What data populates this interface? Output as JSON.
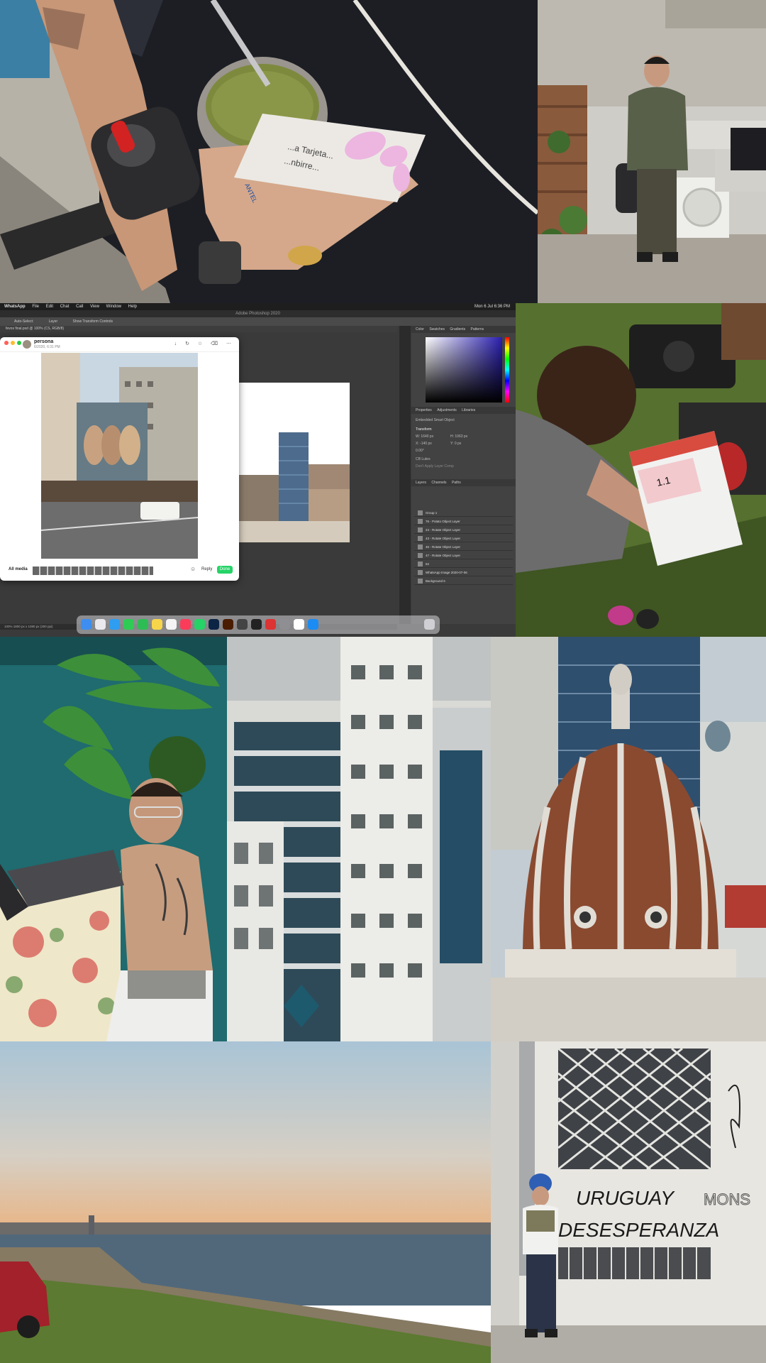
{
  "collage": {
    "tiles": [
      {
        "id": "mate-tile",
        "subject": "hand holding mate gourd with yerba, thermos and card"
      },
      {
        "id": "man-terrace-tile",
        "subject": "man in green jacket standing on rooftop terrace"
      },
      {
        "id": "screenshot-tile",
        "subject": "desktop screenshot of Photoshop and WhatsApp"
      },
      {
        "id": "film-slate-tile",
        "subject": "person writing on a film slate over gear on grass"
      },
      {
        "id": "tattoo-man-tile",
        "subject": "tattooed man at laptop among plants"
      },
      {
        "id": "buildings-tile",
        "subject": "dense white apartment buildings"
      },
      {
        "id": "dome-tile",
        "subject": "copper dome against skyscrapers"
      },
      {
        "id": "coast-tile",
        "subject": "coastline and city skyline at sunset with red car"
      },
      {
        "id": "graffiti-tile",
        "subject": "person in blue cap in front of graffiti wall"
      }
    ]
  },
  "mate_card": {
    "brand_text": "ANTEL",
    "line1": "...a Tarjeta...",
    "line2": "...nbirre..."
  },
  "graffiti": {
    "line1": "URUGUAY",
    "line2": "DESESPERANZA",
    "side": "MONS"
  },
  "screenshot": {
    "menubar": {
      "app": "WhatsApp",
      "items": [
        "File",
        "Edit",
        "Chat",
        "Call",
        "View",
        "Window",
        "Help"
      ],
      "clock": "Mon 6 Jul 6:36 PM"
    },
    "photoshop": {
      "title": "Adobe Photoshop 2020",
      "options": [
        "Auto-Select:",
        "Layer",
        "Show Transform Controls"
      ],
      "doc_tab": "fevos final.psd @ 100% (CS, RGB/8)",
      "panel_tabs_top": [
        "Color",
        "Swatches",
        "Gradients",
        "Patterns"
      ],
      "panel_tabs_mid": [
        "Properties",
        "Adjustments",
        "Libraries"
      ],
      "properties": {
        "kind": "Embedded Smart Object",
        "section": "Transform",
        "w": "W: 1640 px",
        "h": "H: 1063 px",
        "x": "X: -140 px",
        "y": "Y: 0 px",
        "angle": "0.00°",
        "layer_comps": "CB Lutes",
        "hint": "Don't Apply Layer Comp"
      },
      "panel_tabs_bottom": [
        "Layers",
        "Channels",
        "Paths"
      ],
      "layers": [
        "Group 1",
        "76 - Potato Object Layer",
        "24 - Rotate Object Layer",
        "43 - Rotate Object Layer",
        "46 - Rotate Object Layer",
        "47 - Rotate Object Layer",
        "62",
        "WhatsApp Image 2020-07-06",
        "Background 6"
      ],
      "status": "100%   1800 px x 1080 px (300 ppi)"
    },
    "whatsapp": {
      "name": "persona",
      "time": "6/2020, 6:31 PM",
      "tools": "↓ ↻ ☆ ⌫ ⋯",
      "all_media": "All media",
      "reply": "Reply",
      "done": "Done",
      "emoji": "☺"
    }
  },
  "colors": {
    "sky": "#a9c4d6",
    "sunset": "#e9b483",
    "sea": "#51687b",
    "teal_wall": "#1f6b6f",
    "copper": "#8b4a30",
    "grass": "#5c7a31",
    "whatsapp_green": "#25d366",
    "ps_dark": "#3a3a3a"
  }
}
